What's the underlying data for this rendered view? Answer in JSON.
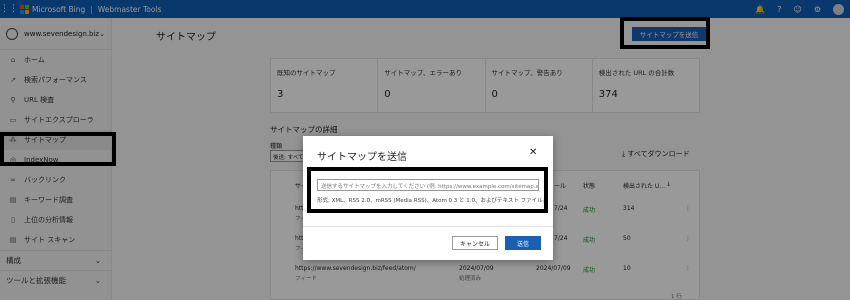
{
  "topbar": {
    "grid_icon": "⋮⋮",
    "brand": "Microsoft Bing",
    "sep": "|",
    "product": "Webmaster Tools",
    "icons": [
      "bell-icon",
      "help-icon",
      "smiley-icon",
      "gear-icon"
    ],
    "bell": "🔔",
    "help": "?",
    "smile": "☺",
    "gear": "⚙",
    "logo_colors": [
      "#f25022",
      "#7fba00",
      "#00a4ef",
      "#ffb900"
    ]
  },
  "sidebar": {
    "site": "www.sevendesign.biz",
    "items": [
      {
        "label": "ホーム",
        "icon": "⌂"
      },
      {
        "label": "検索パフォーマンス",
        "icon": "↗"
      },
      {
        "label": "URL 検査",
        "icon": "⚲"
      },
      {
        "label": "サイトエクスプローラ",
        "icon": "▭"
      },
      {
        "label": "サイトマップ",
        "icon": "⁂"
      },
      {
        "label": "IndexNow",
        "icon": "◎"
      },
      {
        "label": "バックリンク",
        "icon": "∞"
      },
      {
        "label": "キーワード調査",
        "icon": "▤"
      },
      {
        "label": "上位の分析情報",
        "icon": "▯"
      },
      {
        "label": "サイト スキャン",
        "icon": "▤"
      }
    ],
    "sections": [
      "構成",
      "ツールと拡張機能"
    ]
  },
  "main": {
    "title": "サイトマップ",
    "submit_button": "サイトマップを送信",
    "stats": [
      {
        "label": "既知のサイトマップ",
        "value": "3"
      },
      {
        "label": "サイトマップ、エラーあり",
        "value": "0"
      },
      {
        "label": "サイトマップ、警告あり",
        "value": "0"
      },
      {
        "label": "検出された URL の合計数",
        "value": "374"
      }
    ],
    "details_title": "サイトマップの詳細",
    "type_label": "種類",
    "type_value": "後送: すべて",
    "download": "すべてダウンロード",
    "download_icon": "⤓",
    "table": {
      "col_sitemap": "サイ",
      "col_last": "ール",
      "col_status": "状態",
      "col_urls": "検出された U...",
      "sort_icon": "↓",
      "rows": [
        {
          "url": "http",
          "type": "フィー",
          "date1": "",
          "date2": "7/24",
          "status": "成功",
          "count": "314"
        },
        {
          "url": "http",
          "type": "フィー",
          "date1": "",
          "date2": "7/24",
          "status": "成功",
          "count": "50"
        },
        {
          "url": "https://www.sevendesign.biz/feed/atom/",
          "type": "フィード",
          "date1": "2024/07/09",
          "date1_sub": "処理済み",
          "date2": "2024/07/09",
          "status": "成功",
          "count": "10"
        }
      ],
      "kebab": "⋮",
      "page_hint": "1 行"
    }
  },
  "dialog": {
    "title": "サイトマップを送信",
    "close": "✕",
    "input_placeholder": "送信するサイトマップを入力してください (例: https://www.example.com/sitemap.x...",
    "hint": "形式: XML、RSS 2.0、mRSS (Media RSS)、Atom 0.3 と 1.0、およびテキスト ファイル。",
    "cancel": "キャンセル",
    "send": "送信"
  },
  "colors": {
    "topbar": "#0f5fb5",
    "primary_button": "#1a5fb4",
    "success": "#2f7d32"
  }
}
